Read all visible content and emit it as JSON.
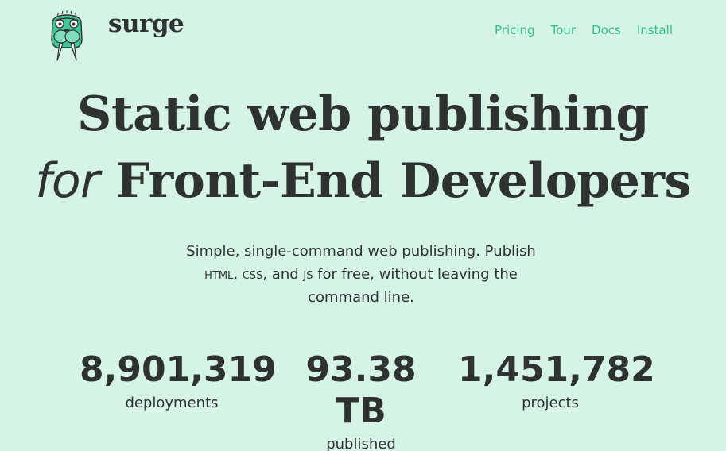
{
  "header": {
    "brand": "surge",
    "logo_icon": "walrus-logo-icon"
  },
  "nav": {
    "items": [
      "Pricing",
      "Tour",
      "Docs",
      "Install"
    ]
  },
  "hero": {
    "line1": "Static web publishing",
    "line2_italic": "for",
    "line2_rest": " Front-End Developers"
  },
  "lede": {
    "part1": "Simple, single-command web publishing. Publish ",
    "html": "HTML",
    "sep1": ", ",
    "css": "CSS",
    "sep2": ", and ",
    "js": "JS",
    "part2": " for free, without leaving the command line."
  },
  "stats": [
    {
      "value": "8,901,319",
      "label": "deployments"
    },
    {
      "value": "93.38 TB",
      "label": "published"
    },
    {
      "value": "1,451,782",
      "label": "projects"
    }
  ],
  "colors": {
    "background": "#d6f4e6",
    "accent": "#2fc18b",
    "text": "#2e3331"
  }
}
